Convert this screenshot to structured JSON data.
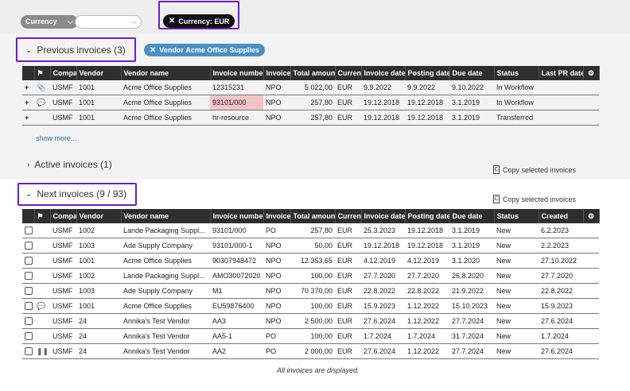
{
  "filters": {
    "field_label": "Currency",
    "field_value": "",
    "active_chip": "Currency: EUR"
  },
  "previous": {
    "title": "Previous invoices (3)",
    "vendor_chip_prefix": "Vendor",
    "vendor_chip_value": "Acme Office Supplies",
    "columns": [
      "",
      "",
      "Company",
      "Vendor",
      "Vendor name",
      "Invoice number",
      "Invoice",
      "Total amount",
      "Currency",
      "Invoice date",
      "Posting date",
      "Due date",
      "Status",
      "Last PR date"
    ],
    "rows": [
      {
        "icon": "paperclip-icon",
        "glyph": "📎",
        "company": "USMF",
        "vendor": "1001",
        "vendor_name": "Acme Office Supplies",
        "invoice_number": "12315231",
        "invoice": "NPO",
        "total": "5 022,00",
        "currency": "EUR",
        "invoice_date": "9.9.2022",
        "posting_date": "9.9.2022",
        "due_date": "9.10.2022",
        "status": "In Workflow",
        "last": "",
        "highlight": false
      },
      {
        "icon": "comment-icon",
        "glyph": "💬",
        "company": "USMF",
        "vendor": "1001",
        "vendor_name": "Acme Office Supplies",
        "invoice_number": "93101/000",
        "invoice": "NPO",
        "total": "257,80",
        "currency": "EUR",
        "invoice_date": "19.12.2018",
        "posting_date": "19.12.2018",
        "due_date": "3.1.2019",
        "status": "In Workflow",
        "last": "",
        "highlight": true
      },
      {
        "icon": "",
        "glyph": "",
        "company": "USMF",
        "vendor": "1001",
        "vendor_name": "Acme Office Supplies",
        "invoice_number": "hr-resource",
        "invoice": "NPO",
        "total": "257,80",
        "currency": "EUR",
        "invoice_date": "19.12.2018",
        "posting_date": "19.12.2018",
        "due_date": "3.1.2019",
        "status": "Transferred",
        "last": "",
        "highlight": false
      }
    ],
    "show_more": "show more..."
  },
  "active": {
    "title": "Active invoices (1)",
    "copy_label": "Copy selected invoices"
  },
  "next": {
    "title": "Next invoices (9 / 93)",
    "copy_label": "Copy selected invoices",
    "columns": [
      "",
      "",
      "Company",
      "Vendor",
      "Vendor name",
      "Invoice number",
      "Invoice",
      "Total amount",
      "Currency",
      "Invoice date",
      "Posting date",
      "Due date",
      "Status",
      "Created"
    ],
    "rows": [
      {
        "icon": "",
        "glyph": "",
        "company": "USMF",
        "vendor": "1002",
        "vendor_name": "Lande Packaging Suppl...",
        "invoice_number": "93101/000",
        "invoice": "PO",
        "total": "257,80",
        "currency": "EUR",
        "invoice_date": "25.3.2023",
        "posting_date": "19.12.2018",
        "due_date": "3.1.2019",
        "status": "New",
        "created": "6.2.2023"
      },
      {
        "icon": "",
        "glyph": "",
        "company": "USMF",
        "vendor": "1003",
        "vendor_name": "Ade Supply Company",
        "invoice_number": "93101/000-1",
        "invoice": "NPO",
        "total": "50,00",
        "currency": "EUR",
        "invoice_date": "19.12.2018",
        "posting_date": "19.12.2018",
        "due_date": "3.1.2019",
        "status": "New",
        "created": "2.2.2023"
      },
      {
        "icon": "",
        "glyph": "",
        "company": "USMF",
        "vendor": "1001",
        "vendor_name": "Acme Office Supplies",
        "invoice_number": "90307948472",
        "invoice": "NPO",
        "total": "12 353,65",
        "currency": "EUR",
        "invoice_date": "4.12.2019",
        "posting_date": "4.12.2019",
        "due_date": "3.1.2020",
        "status": "New",
        "created": "27.10.2022"
      },
      {
        "icon": "",
        "glyph": "",
        "company": "USMF",
        "vendor": "1002",
        "vendor_name": "Lande Packaging Suppl...",
        "invoice_number": "AMO30072020",
        "invoice": "NPO",
        "total": "100,00",
        "currency": "EUR",
        "invoice_date": "27.7.2020",
        "posting_date": "27.7.2020",
        "due_date": "26.8.2020",
        "status": "New",
        "created": "27.7.2020"
      },
      {
        "icon": "",
        "glyph": "",
        "company": "USMF",
        "vendor": "1003",
        "vendor_name": "Ade Supply Company",
        "invoice_number": "M1",
        "invoice": "NPO",
        "total": "70 370,00",
        "currency": "EUR",
        "invoice_date": "22.8.2022",
        "posting_date": "22.8.2022",
        "due_date": "21.9.2022",
        "status": "New",
        "created": "22.8.2022"
      },
      {
        "icon": "comment-icon",
        "glyph": "💬",
        "company": "USMF",
        "vendor": "1001",
        "vendor_name": "Acme Office Supplies",
        "invoice_number": "EU59876400",
        "invoice": "NPO",
        "total": "100,00",
        "currency": "EUR",
        "invoice_date": "15.9.2023",
        "posting_date": "1.12.2022",
        "due_date": "15.10.2023",
        "status": "New",
        "created": "15.9.2023"
      },
      {
        "icon": "",
        "glyph": "",
        "company": "USMF",
        "vendor": "24",
        "vendor_name": "Annika's Test Vendor",
        "invoice_number": "AA3",
        "invoice": "NPO",
        "total": "2 500,00",
        "currency": "EUR",
        "invoice_date": "27.6.2024",
        "posting_date": "1.12.2022",
        "due_date": "27.7.2024",
        "status": "New",
        "created": "27.6.2024"
      },
      {
        "icon": "",
        "glyph": "",
        "company": "USMF",
        "vendor": "24",
        "vendor_name": "Annika's Test Vendor",
        "invoice_number": "AA5-1",
        "invoice": "PO",
        "total": "100,00",
        "currency": "EUR",
        "invoice_date": "1.7.2024",
        "posting_date": "1.7.2024",
        "due_date": "31.7.2024",
        "status": "New",
        "created": "1.7.2024"
      },
      {
        "icon": "pause-icon",
        "glyph": "❚❚",
        "company": "USMF",
        "vendor": "24",
        "vendor_name": "Annika's Test Vendor",
        "invoice_number": "AA2",
        "invoice": "PO",
        "total": "2 000,00",
        "currency": "EUR",
        "invoice_date": "27.6.2024",
        "posting_date": "1.12.2022",
        "due_date": "27.7.2024",
        "status": "New",
        "created": "27.6.2024"
      }
    ],
    "footer": "All invoices are displayed."
  }
}
